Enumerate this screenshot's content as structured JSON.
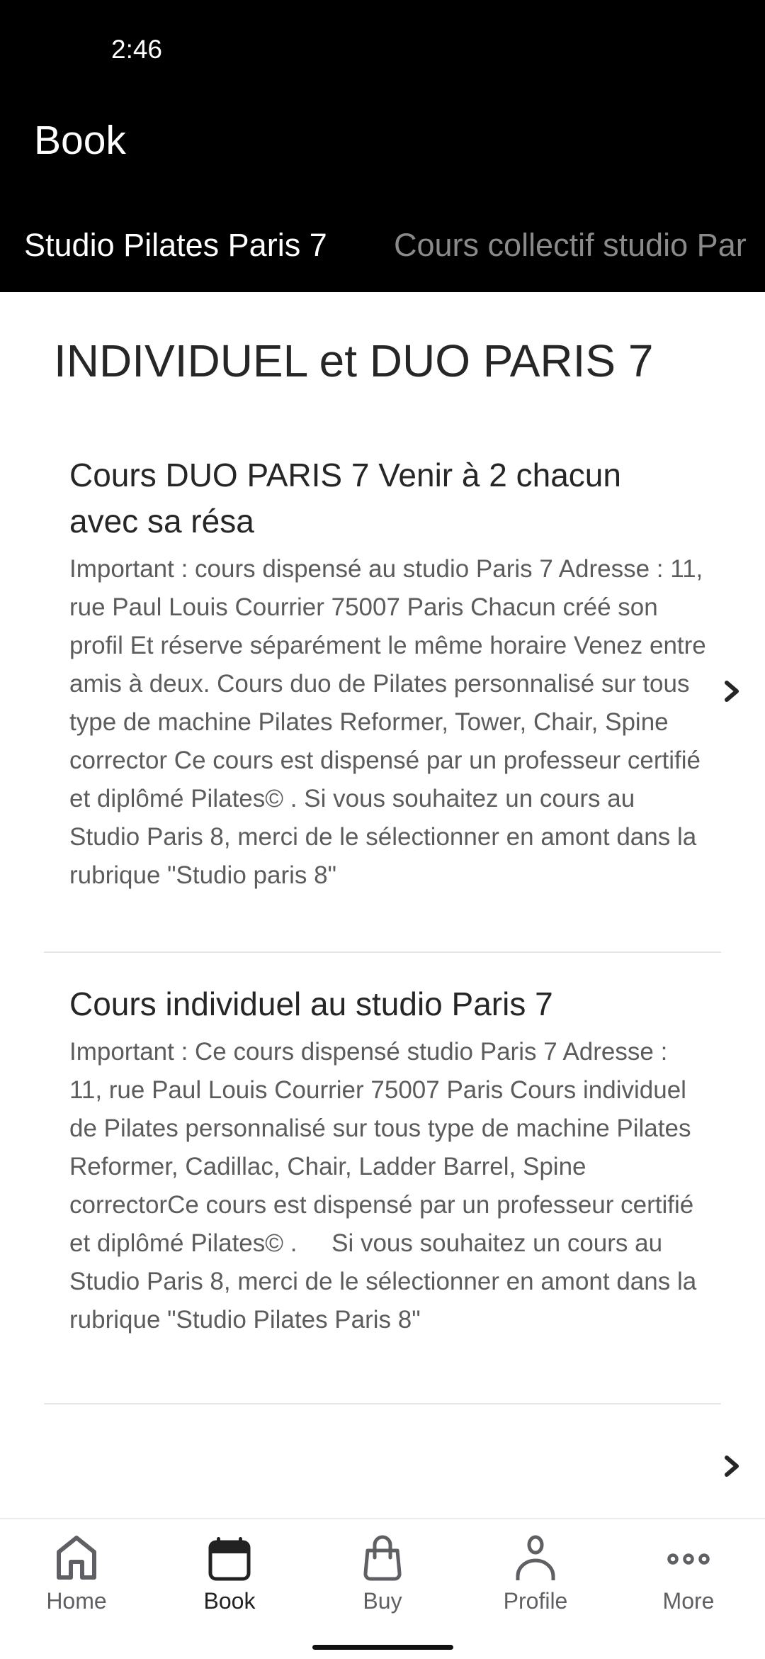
{
  "status_bar": {
    "time": "2:46"
  },
  "header": {
    "title": "Book",
    "tabs": [
      {
        "label": "Studio Pilates Paris 7",
        "active": true
      },
      {
        "label": "Cours collectif studio Par",
        "active": false
      }
    ]
  },
  "main": {
    "section_heading": "INDIVIDUEL et DUO PARIS 7",
    "items": [
      {
        "title": "Cours DUO PARIS 7 Venir à 2 chacun avec sa résa",
        "description": "Important : cours dispensé au studio Paris 7 Adresse : 11, rue Paul Louis Courrier 75007 Paris Chacun créé son profil Et réserve séparément le même horaire Venez entre amis à deux. Cours duo de Pilates personnalisé sur tous type de machine Pilates Reformer, Tower, Chair, Spine corrector Ce cours est dispensé par un professeur certifié et diplômé Pilates© . Si vous souhaitez un cours au Studio Paris 8, merci de le sélectionner en amont dans la rubrique \"Studio paris 8\"",
        "icon": "chevron-right-icon"
      },
      {
        "title": "Cours individuel au studio Paris 7",
        "description": "Important : Ce cours dispensé studio Paris 7 Adresse : 11, rue Paul Louis Courrier 75007 Paris Cours individuel de Pilates personnalisé sur tous type de machine Pilates Reformer, Cadillac, Chair, Ladder Barrel, Spine correctorCe cours est dispensé par un professeur certifié et diplômé Pilates© .     Si vous souhaitez un cours au Studio Paris 8, merci de le sélectionner en amont dans la rubrique \"Studio Pilates Paris 8\"",
        "icon": "chevron-right-icon"
      }
    ]
  },
  "bottom_nav": {
    "items": [
      {
        "label": "Home",
        "icon": "home-icon",
        "active": false
      },
      {
        "label": "Book",
        "icon": "calendar-icon",
        "active": true
      },
      {
        "label": "Buy",
        "icon": "shopping-bag-icon",
        "active": false
      },
      {
        "label": "Profile",
        "icon": "person-icon",
        "active": false
      },
      {
        "label": "More",
        "icon": "more-horizontal-icon",
        "active": false
      }
    ]
  },
  "colors": {
    "header_bg": "#000000",
    "tab_active": "#ffffff",
    "tab_inactive": "#8a8a8a",
    "title_text": "#262626",
    "body_text": "#5c5c5c",
    "nav_inactive": "#5f6064",
    "nav_active": "#222222"
  }
}
